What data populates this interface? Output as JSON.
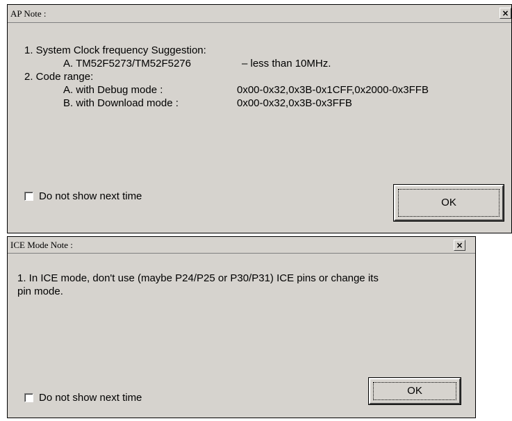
{
  "dialogs": {
    "ap_note": {
      "title": "AP Note :",
      "close_glyph": "×",
      "lines": [
        "1. System Clock frequency Suggestion:",
        "A. TM52F5273/TM52F5276",
        "– less than 10MHz.",
        "2. Code range:",
        "A. with Debug mode :",
        "0x00-0x32,0x3B-0x1CFF,0x2000-0x3FFB",
        "B. with Download mode :",
        "0x00-0x32,0x3B-0x3FFB"
      ],
      "checkbox_label": "Do not show next time",
      "checkbox_checked": false,
      "ok_label": "OK"
    },
    "ice_note": {
      "title": "ICE Mode Note :",
      "close_glyph": "×",
      "lines": [
        "1. In ICE mode, don't use (maybe P24/P25 or P30/P31) ICE pins or change its",
        "pin mode."
      ],
      "checkbox_label": "Do not show next time",
      "checkbox_checked": false,
      "ok_label": "OK"
    }
  },
  "colors": {
    "dialog_bg": "#d6d3ce",
    "border": "#000000"
  },
  "icons": [
    "close-icon",
    "close-icon"
  ]
}
